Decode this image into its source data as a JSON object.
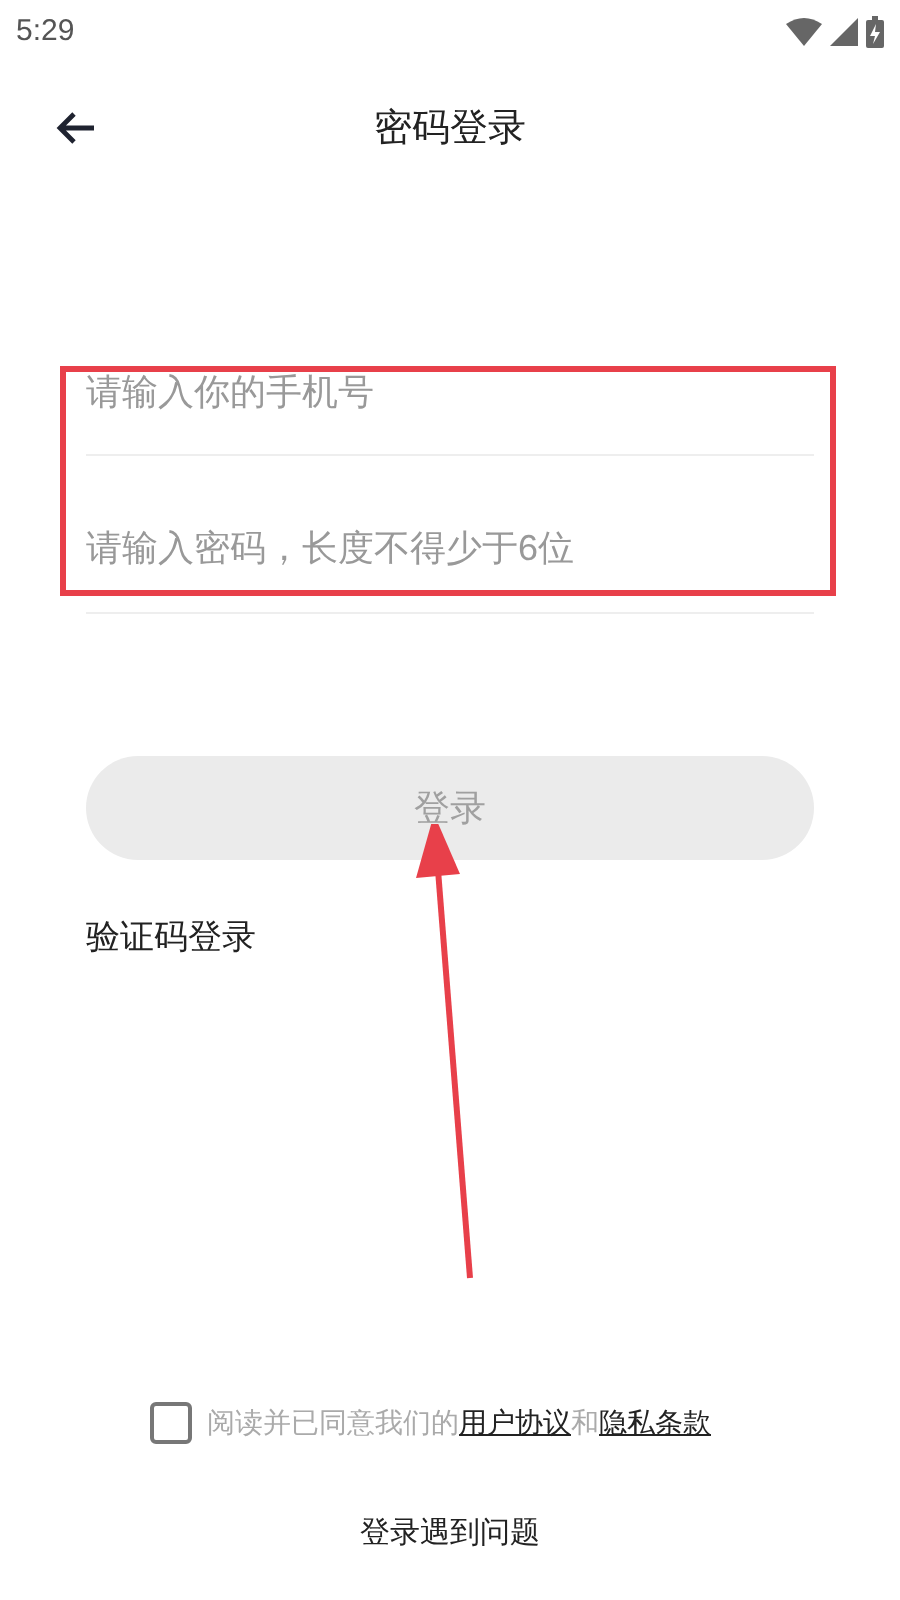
{
  "status_bar": {
    "time": "5:29"
  },
  "header": {
    "title": "密码登录"
  },
  "fields": [
    {
      "placeholder": "请输入你的手机号"
    },
    {
      "placeholder": "请输入密码，长度不得少于6位"
    }
  ],
  "login_button": {
    "label": "登录",
    "disabled": true
  },
  "alt_login": "验证码登录",
  "agreement": {
    "checked": false,
    "text": "阅读并已同意我们的",
    "link_1": "用户协议",
    "joiner": "和",
    "link_2": "隐私条款"
  },
  "help": "登录遇到问题"
}
